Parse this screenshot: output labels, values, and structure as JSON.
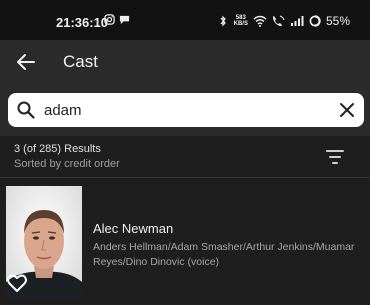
{
  "status_bar": {
    "time": "21:36:10",
    "net_speed_value": "583",
    "net_speed_unit": "KB/S",
    "battery": "55%"
  },
  "app_bar": {
    "title": "Cast"
  },
  "search": {
    "value": "adam"
  },
  "results": {
    "count_text": "3 (of 285) Results",
    "sort_text": "Sorted by credit order"
  },
  "cast": [
    {
      "name": "Alec Newman",
      "roles": "Anders Hellman/Adam Smasher/Arthur Jenkins/Muamar Reyes/Dino Dinovic (voice)"
    }
  ]
}
